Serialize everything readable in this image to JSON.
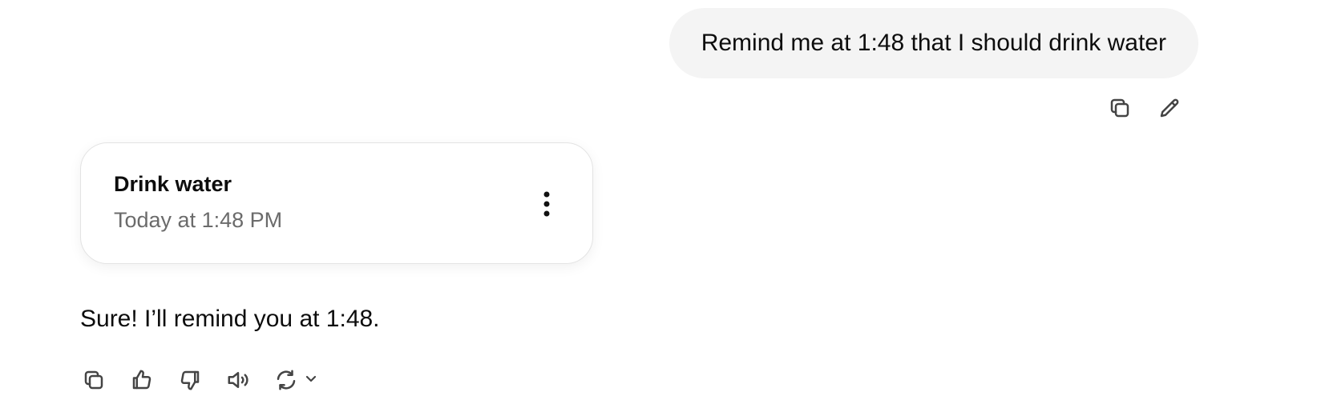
{
  "user_message": {
    "text": "Remind me at 1:48 that I should drink water",
    "actions": [
      "copy-icon",
      "edit-icon"
    ]
  },
  "reminder_card": {
    "title": "Drink water",
    "time": "Today at 1:48 PM",
    "menu_icon": "more-vertical-icon"
  },
  "assistant_message": {
    "text": "Sure! I’ll remind you at 1:48.",
    "actions": [
      "copy-icon",
      "thumbs-up-icon",
      "thumbs-down-icon",
      "read-aloud-icon",
      "regenerate-icon",
      "chevron-down-icon"
    ]
  },
  "colors": {
    "user_bubble_bg": "#f4f4f4",
    "card_border": "#e3e3e3",
    "secondary_text": "#6b6b6b",
    "icon": "#444444"
  }
}
